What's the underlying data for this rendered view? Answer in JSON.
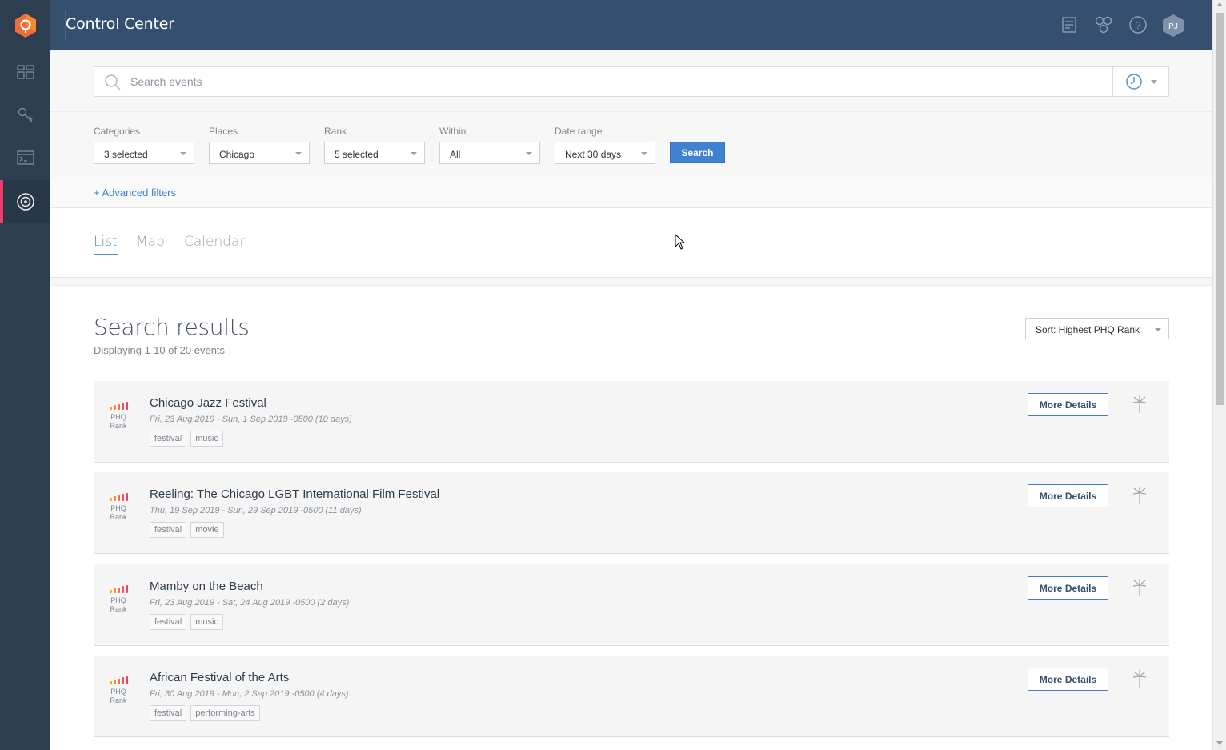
{
  "app": {
    "title": "Control Center",
    "avatar_initials": "PJ"
  },
  "sidebar": {
    "items": [
      {
        "icon": "dashboard-icon"
      },
      {
        "icon": "key-icon"
      },
      {
        "icon": "terminal-icon"
      },
      {
        "icon": "target-icon",
        "active": true
      }
    ]
  },
  "header": {
    "icons": [
      "document-icon",
      "apps-icon",
      "help-icon"
    ]
  },
  "search": {
    "placeholder": "Search events"
  },
  "filters": {
    "categories": {
      "label": "Categories",
      "value": "3 selected"
    },
    "places": {
      "label": "Places",
      "value": "Chicago"
    },
    "rank": {
      "label": "Rank",
      "value": "5 selected"
    },
    "within": {
      "label": "Within",
      "value": "All"
    },
    "date_range": {
      "label": "Date range",
      "value": "Next 30 days"
    },
    "search_button": "Search",
    "advanced": "+ Advanced filters"
  },
  "tabs": [
    "List",
    "Map",
    "Calendar"
  ],
  "results": {
    "title": "Search results",
    "subtitle": "Displaying 1-10 of 20 events",
    "sort": "Sort: Highest PHQ Rank",
    "rank_label_1": "PHQ",
    "rank_label_2": "Rank",
    "more_details": "More Details",
    "events": [
      {
        "title": "Chicago Jazz Festival",
        "date": "Fri, 23 Aug 2019 - Sun, 1 Sep 2019 -0500 (10 days)",
        "tags": [
          "festival",
          "music"
        ]
      },
      {
        "title": "Reeling: The Chicago LGBT International Film Festival",
        "date": "Thu, 19 Sep 2019 - Sun, 29 Sep 2019 -0500 (11 days)",
        "tags": [
          "festival",
          "movie"
        ]
      },
      {
        "title": "Mamby on the Beach",
        "date": "Fri, 23 Aug 2019 - Sat, 24 Aug 2019 -0500 (2 days)",
        "tags": [
          "festival",
          "music"
        ]
      },
      {
        "title": "African Festival of the Arts",
        "date": "Fri, 30 Aug 2019 - Mon, 2 Sep 2019 -0500 (4 days)",
        "tags": [
          "festival",
          "performing-arts"
        ]
      }
    ]
  },
  "colors": {
    "sidebar": "#2c3e50",
    "header": "#34506e",
    "accent": "#3f82cf",
    "active_marker": "#ee3d6a"
  }
}
